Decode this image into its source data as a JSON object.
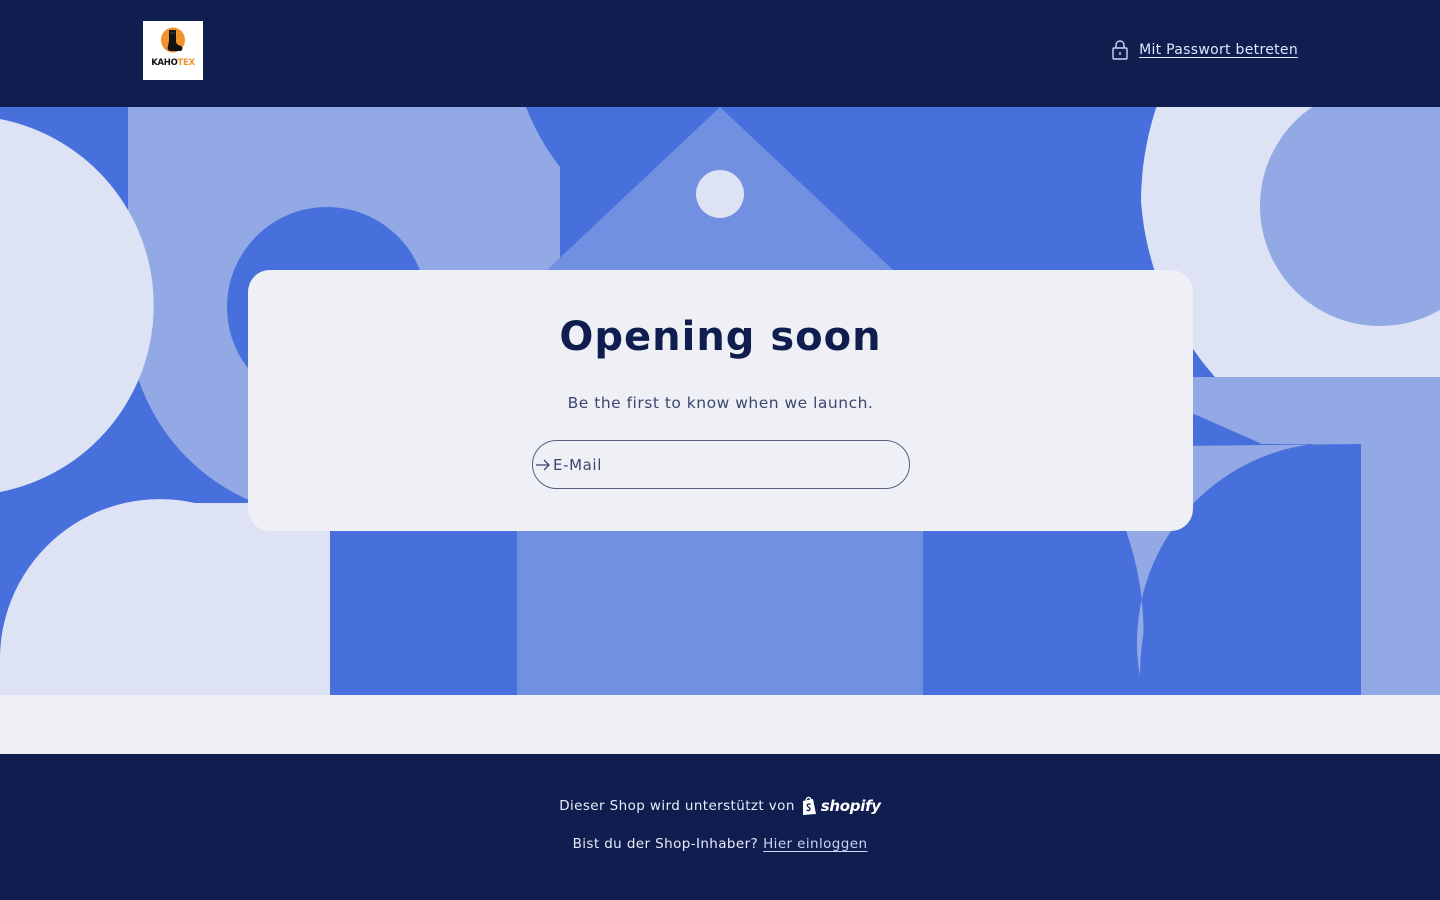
{
  "header": {
    "logo": {
      "alt": "KAHOTEX",
      "text_dark": "KAHO",
      "text_accent": "TEX",
      "icon": "sock-logo-icon"
    },
    "password_link": {
      "icon": "lock-icon",
      "label": "Mit Passwort betreten"
    }
  },
  "main": {
    "title": "Opening soon",
    "subtitle": "Be the first to know when we launch.",
    "email": {
      "placeholder": "E-Mail",
      "value": "",
      "submit_icon": "arrow-right-icon"
    }
  },
  "footer": {
    "powered_by": "Dieser Shop wird unterstützt von",
    "shopify_wordmark": "shopify",
    "shopify_icon": "shopify-bag-icon",
    "owner_question": "Bist du der Shop-Inhaber?",
    "login_link": "Hier einloggen"
  },
  "colors": {
    "navy": "#0f1d4f",
    "background": "#eef0f6",
    "banner_blue": "#4870dc",
    "banner_light": "#93a9e6",
    "banner_mid": "#7190e2",
    "banner_pale": "#dde3f5",
    "logo_accent": "#f0932b"
  }
}
